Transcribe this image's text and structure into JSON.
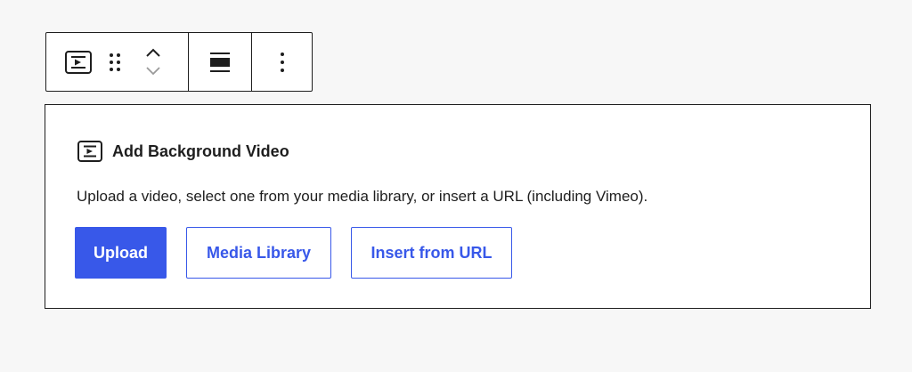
{
  "toolbar": {
    "block_icon": "video-icon",
    "drag_icon": "drag-handle-icon",
    "move_up_icon": "chevron-up-icon",
    "move_down_icon": "chevron-down-icon",
    "align_icon": "align-full-width-icon",
    "options_icon": "more-vertical-icon"
  },
  "placeholder": {
    "icon": "video-icon",
    "title": "Add Background Video",
    "instructions": "Upload a video, select one from your media library, or insert a URL (including Vimeo).",
    "buttons": {
      "upload": "Upload",
      "media_library": "Media Library",
      "insert_url": "Insert from URL"
    }
  },
  "colors": {
    "accent": "#3858e9",
    "text": "#1e1e1e",
    "page_background": "#f7f7f7",
    "panel_background": "#ffffff"
  }
}
